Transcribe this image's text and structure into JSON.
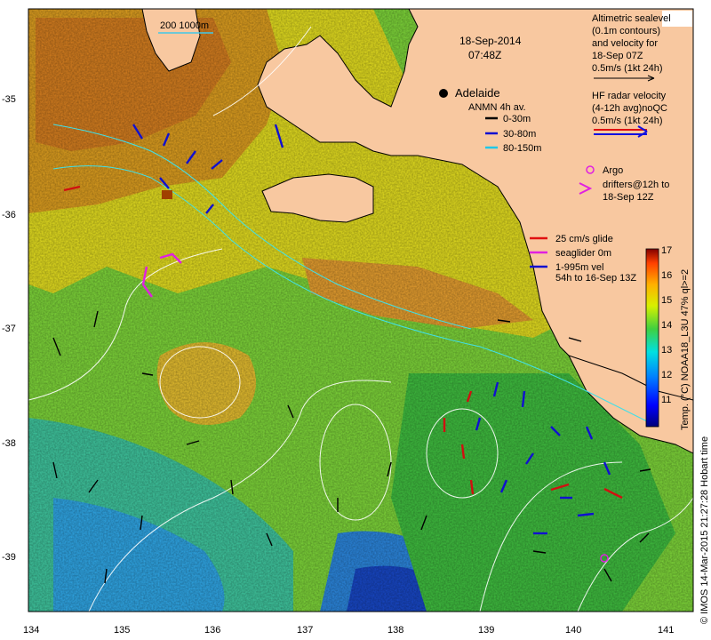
{
  "map": {
    "date": "18-Sep-2014",
    "time": "07:48Z",
    "city": "Adelaide",
    "scale_label": "200  1000m",
    "legend_altimetric": [
      "Altimetric sealevel",
      "(0.1m contours)",
      "and velocity for",
      "18-Sep 07Z",
      "0.5m/s (1kt 24h)"
    ],
    "legend_hf": [
      "HF radar velocity",
      "(4-12h avg)noQC",
      "0.5m/s (1kt 24h)"
    ],
    "legend_anmn_title": "ANMN 4h av.",
    "legend_anmn": [
      {
        "label": "0-30m",
        "color": "#000000"
      },
      {
        "label": "30-80m",
        "color": "#1010d0"
      },
      {
        "label": "80-150m",
        "color": "#20c8e8"
      }
    ],
    "legend_argo": [
      "Argo",
      "drifters@12h to",
      "18-Sep 12Z"
    ],
    "legend_glider": [
      "25 cm/s glide",
      "seaglider 0m",
      "1-995m vel",
      "54h to 16-Sep 13Z"
    ],
    "colorbar_label": "Temp. (°C) NOAA18_L3U 47% ql>=2",
    "colorbar_ticks": [
      "17",
      "16",
      "15",
      "14",
      "13",
      "12",
      "11"
    ],
    "credit": "© IMOS 14-Mar-2015 21:27:28 Hobart time",
    "x_ticks": [
      "134",
      "135",
      "136",
      "137",
      "138",
      "139",
      "140",
      "141"
    ],
    "y_ticks": [
      "-35",
      "-36",
      "-37",
      "-38",
      "-39"
    ],
    "colors": {
      "land": "#f8c8a0",
      "warm": "#e88a20",
      "cool": "#2080e8",
      "deep": "#1030c0"
    }
  }
}
